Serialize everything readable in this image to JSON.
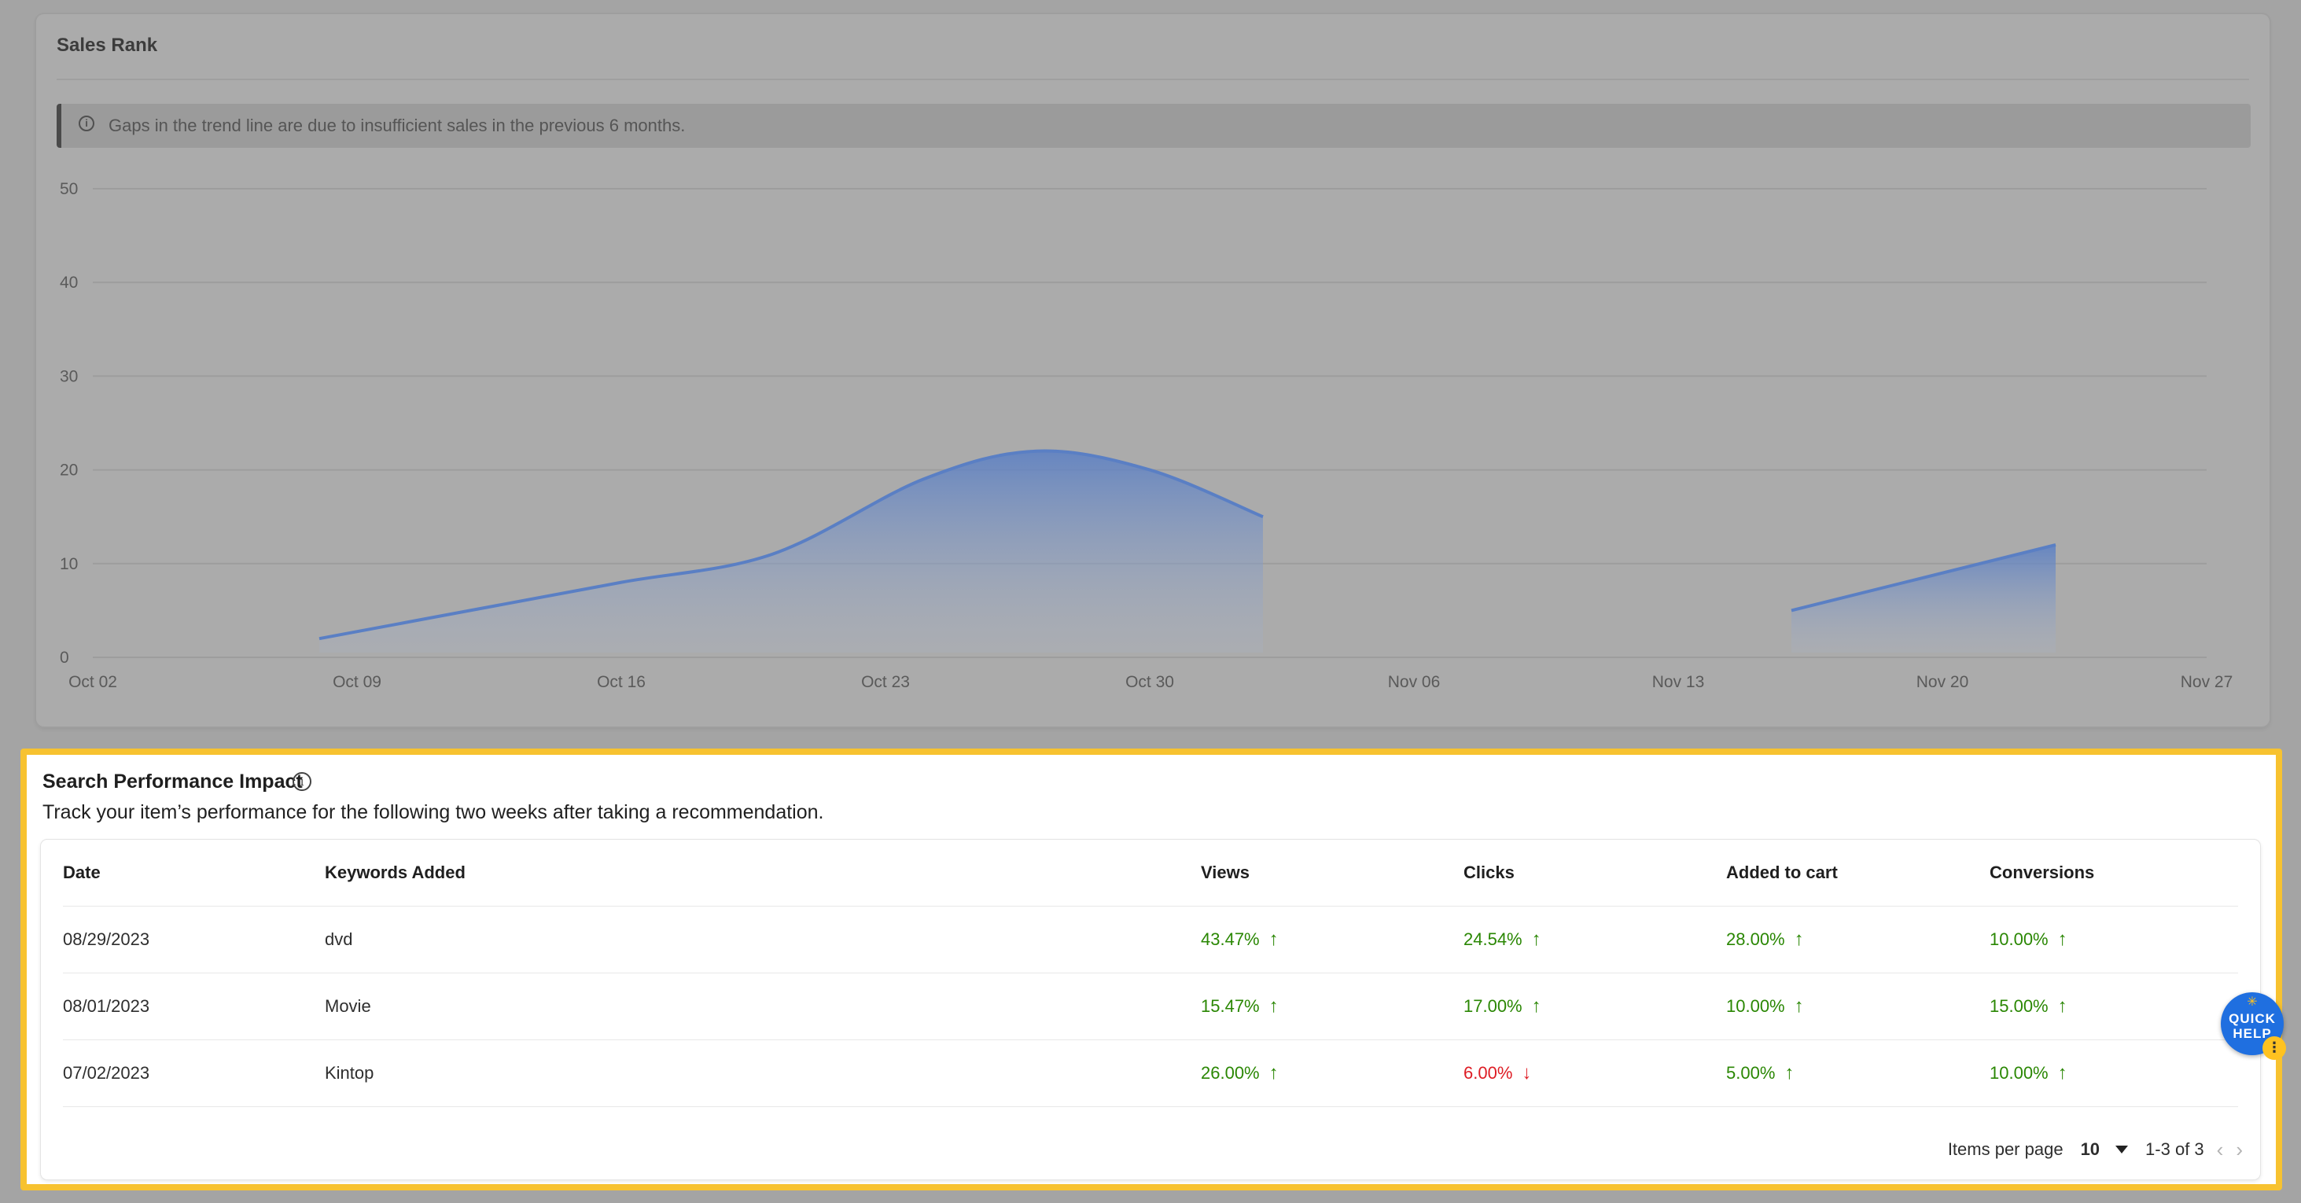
{
  "sales_rank": {
    "title": "Sales Rank",
    "banner_icon": "info-circle-icon",
    "banner_text": "Gaps in the trend line are due to insufficient sales in the previous 6 months."
  },
  "chart_data": {
    "type": "area",
    "title": "Sales Rank",
    "xlabel": "",
    "ylabel": "",
    "x_ticks": [
      "Oct 02",
      "Oct 09",
      "Oct 16",
      "Oct 23",
      "Oct 30",
      "Nov 06",
      "Nov 13",
      "Nov 20",
      "Nov 27"
    ],
    "y_ticks": [
      0,
      10,
      20,
      30,
      40,
      50
    ],
    "ylim": [
      0,
      50
    ],
    "xlim": [
      "2023-10-02",
      "2023-11-27"
    ],
    "grid": true,
    "legend": "none",
    "color": "#5a7fc4",
    "segments": [
      {
        "points": [
          {
            "x": "2023-10-08",
            "y": 2
          },
          {
            "x": "2023-10-12",
            "y": 5
          },
          {
            "x": "2023-10-16",
            "y": 8
          },
          {
            "x": "2023-10-20",
            "y": 11
          },
          {
            "x": "2023-10-24",
            "y": 19
          },
          {
            "x": "2023-10-27",
            "y": 22
          },
          {
            "x": "2023-10-30",
            "y": 20
          },
          {
            "x": "2023-11-02",
            "y": 15
          }
        ]
      },
      {
        "points": [
          {
            "x": "2023-11-16",
            "y": 5
          },
          {
            "x": "2023-11-23",
            "y": 12
          }
        ]
      }
    ]
  },
  "impact": {
    "title": "Search Performance Impact",
    "info_icon": "info-circle-icon",
    "subtitle": "Track your item’s performance for the following two weeks after taking a recommendation.",
    "columns": [
      "Date",
      "Keywords Added",
      "Views",
      "Clicks",
      "Added to cart",
      "Conversions"
    ],
    "rows": [
      {
        "date": "08/29/2023",
        "keyword": "dvd",
        "views": {
          "value": "43.47%",
          "trend": "up"
        },
        "clicks": {
          "value": "24.54%",
          "trend": "up"
        },
        "cart": {
          "value": "28.00%",
          "trend": "up"
        },
        "conversions": {
          "value": "10.00%",
          "trend": "up"
        }
      },
      {
        "date": "08/01/2023",
        "keyword": "Movie",
        "views": {
          "value": "15.47%",
          "trend": "up"
        },
        "clicks": {
          "value": "17.00%",
          "trend": "up"
        },
        "cart": {
          "value": "10.00%",
          "trend": "up"
        },
        "conversions": {
          "value": "15.00%",
          "trend": "up"
        }
      },
      {
        "date": "07/02/2023",
        "keyword": "Kintop",
        "views": {
          "value": "26.00%",
          "trend": "up"
        },
        "clicks": {
          "value": "6.00%",
          "trend": "down"
        },
        "cart": {
          "value": "5.00%",
          "trend": "up"
        },
        "conversions": {
          "value": "10.00%",
          "trend": "up"
        }
      }
    ],
    "pagination": {
      "items_per_page_label": "Items per page",
      "items_per_page_value": "10",
      "range_text": "1-3 of 3"
    }
  },
  "quick_help": {
    "label_line1": "QUICK",
    "label_line2": "HELP"
  },
  "colors": {
    "up": "#2a8703",
    "down": "#de1c24",
    "highlight": "#f7c230",
    "accent": "#1f6fe0"
  }
}
